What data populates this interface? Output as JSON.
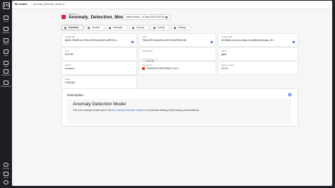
{
  "app": {
    "logo_text": "[t]"
  },
  "sidebar": {
    "items": [
      {
        "label": "Home",
        "icon": "home-icon"
      },
      {
        "label": "Datasets",
        "icon": "database-icon"
      },
      {
        "label": "Models",
        "icon": "cube-icon"
      },
      {
        "label": "Apps",
        "icon": "grid-icon"
      },
      {
        "label": "Jobs",
        "icon": "briefcase-icon"
      },
      {
        "label": "Notebooks",
        "icon": "notebook-icon"
      },
      {
        "label": "Workspaces",
        "icon": "folder-icon"
      }
    ],
    "bottom": [
      {
        "label": "Settings",
        "icon": "gear-icon"
      },
      {
        "label": "Docs",
        "icon": "book-icon"
      },
      {
        "label": "Help",
        "icon": "help-icon"
      }
    ]
  },
  "breadcrumb": {
    "first": "ML models",
    "separator": "/",
    "second": "Anomaly_Detection_Model_tf"
  },
  "header": {
    "kicker": "FROM CA",
    "title": "Anomaly_Detection_Model_tf",
    "version_label": "Latest version - 14 May 2024 01:02:03"
  },
  "tabs": [
    {
      "label": "Overview",
      "active": true,
      "icon": "grid-icon"
    },
    {
      "label": "Preview",
      "active": false,
      "icon": "eye-icon"
    },
    {
      "label": "Metadata",
      "active": false,
      "icon": "tag-icon"
    },
    {
      "label": "Sharing",
      "active": false,
      "icon": "share-icon"
    },
    {
      "label": "Activity",
      "active": false,
      "icon": "clock-icon"
    },
    {
      "label": "Settings",
      "active": false,
      "icon": "gear-icon"
    }
  ],
  "fields": {
    "tiledb_uri": {
      "key": "TileDB URI",
      "value": "tiledb://TileDB-Inc/72bcc478-9cda-4b04-a570-5e1..."
    },
    "uuid": {
      "key": "UUID",
      "value": "72bcc478-9cda-4b04-a570-5e1d7819d1d0"
    },
    "original_uri": {
      "key": "Original URI",
      "value": "s3://tiledb-inc-demo-data-ml-public/notebooks_ref/..."
    },
    "size": {
      "key": "Size",
      "value": "574 KiB"
    },
    "serialization": {
      "key": "Serialization",
      "value": "cloudpickle"
    },
    "author": {
      "key": "Author",
      "value": "garik"
    },
    "region": {
      "key": "Region",
      "value": "us-east-1"
    },
    "framework": {
      "key": "Framework",
      "value": "TENSORFLOW KERAS 2.11.0"
    },
    "python_version": {
      "key": "Python version",
      "value": "3.9.19"
    },
    "stage": {
      "key": "Stage",
      "value": "STAGING"
    }
  },
  "description": {
    "heading": "Description",
    "title": "Anomaly Detection Model",
    "text_before": "This is an example model used in the",
    "link": "ML Anomaly Detection notebook",
    "text_after": "to showcase training, model saving and predictions."
  },
  "colors": {
    "accent": "#2f5fd6",
    "brand_red": "#d7263d",
    "sidebar": "#1d1f22"
  }
}
